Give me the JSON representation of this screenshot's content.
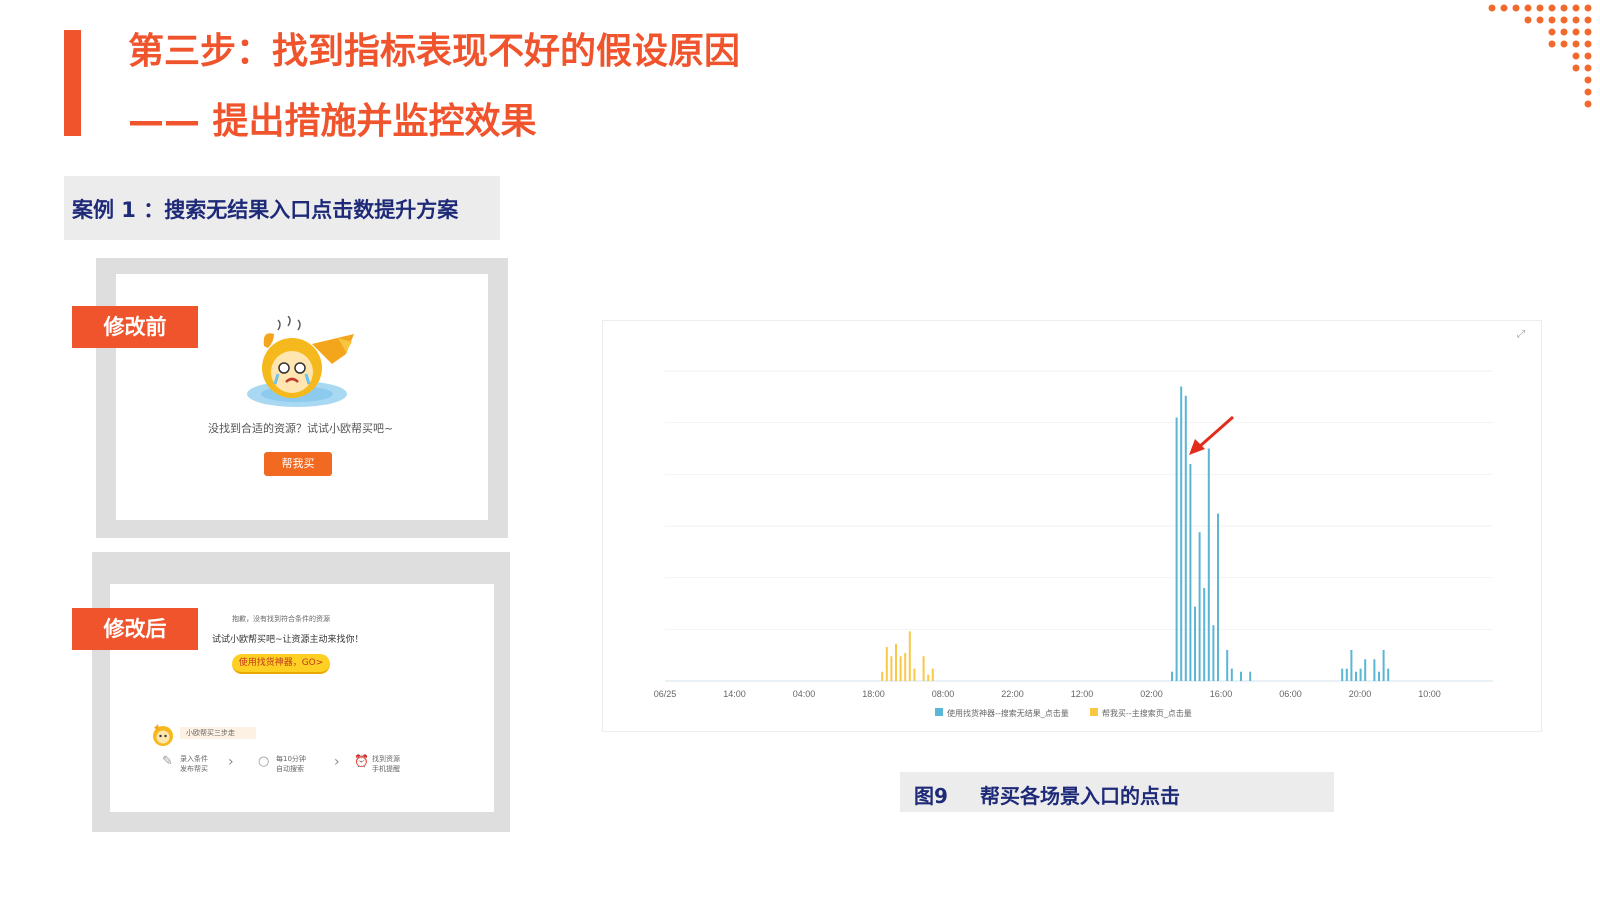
{
  "header": {
    "title_line1": "第三步：找到指标表现不好的假设原因",
    "title_line2": "—— 提出措施并监控效果"
  },
  "case": {
    "label": "案例 1 ：搜索无结果入口点击数提升方案"
  },
  "before": {
    "tag": "修改前",
    "message": "没找到合适的资源？试试小欧帮买吧~",
    "button": "帮我买"
  },
  "after": {
    "tag": "修改后",
    "line1": "抱歉，没有找到符合条件的资源",
    "line2": "试试小欧帮买吧~让资源主动来找你！",
    "button": "使用找货神器，GO>",
    "steps_title": "小欧帮买三步走",
    "steps": [
      {
        "line1": "录入条件",
        "line2": "发布帮买"
      },
      {
        "line1": "每10分钟",
        "line2": "自动搜索"
      },
      {
        "line1": "找到资源",
        "line2": "手机提醒"
      }
    ]
  },
  "chart_data": {
    "type": "bar",
    "x_tick_labels": [
      "06/25",
      "14:00",
      "04:00",
      "18:00",
      "08:00",
      "22:00",
      "12:00",
      "02:00",
      "16:00",
      "06:00",
      "20:00",
      "10:00"
    ],
    "y_axis_labels_shown": false,
    "grid": true,
    "legend_position": "bottom",
    "series": [
      {
        "name": "使用找货神器--搜索无结果_点击量",
        "color": "#5bb6d6",
        "values": [
          0,
          0,
          0,
          0,
          0,
          0,
          0,
          0,
          0,
          0,
          0,
          0,
          0,
          0,
          0,
          0,
          0,
          0,
          0,
          0,
          0,
          0,
          0,
          0,
          0,
          0,
          0,
          0,
          0,
          0,
          0,
          0,
          0,
          0,
          0,
          0,
          0,
          0,
          0,
          0,
          0,
          0,
          0,
          0,
          0,
          0,
          0,
          0,
          0,
          0,
          0,
          0,
          0,
          0,
          0,
          0,
          0,
          0,
          0,
          0,
          0,
          0,
          0,
          0,
          0,
          0,
          0,
          0,
          0,
          0,
          0,
          0,
          0,
          0,
          0,
          0,
          0,
          0,
          0,
          0,
          0,
          0,
          0,
          0,
          0,
          0,
          0,
          0,
          0,
          0,
          0,
          0,
          0,
          0,
          0,
          0,
          0,
          0,
          0,
          0,
          0,
          0,
          0,
          0,
          0,
          0,
          0,
          0,
          0,
          0,
          0,
          0,
          0,
          0,
          0,
          0,
          0,
          0,
          0,
          0,
          0,
          0,
          0,
          0,
          0,
          0,
          0,
          0,
          0,
          0,
          0,
          0,
          0,
          0,
          0,
          0,
          0,
          0,
          0,
          0,
          0,
          0,
          0,
          0,
          0,
          0,
          0,
          0,
          0,
          0,
          0,
          0,
          0,
          0,
          0,
          0,
          0,
          0,
          0,
          0,
          0,
          0,
          0,
          0,
          0,
          0,
          0,
          0,
          0,
          0,
          0,
          0,
          0,
          0,
          0,
          0,
          0,
          0,
          0,
          0,
          0,
          0,
          0,
          0,
          0,
          0,
          0,
          0,
          0,
          0,
          0,
          0,
          0,
          0,
          0,
          0,
          0,
          0,
          0,
          0,
          0,
          0,
          0,
          0,
          0,
          0,
          0,
          0,
          0,
          0,
          0,
          0,
          0,
          0,
          0,
          0,
          0,
          0,
          0,
          0,
          3,
          0,
          85,
          0,
          95,
          0,
          92,
          0,
          70,
          0,
          24,
          0,
          48,
          0,
          30,
          0,
          75,
          0,
          18,
          0,
          54,
          0,
          0,
          0,
          10,
          0,
          4,
          0,
          0,
          0,
          3,
          0,
          0,
          0,
          3,
          0,
          0,
          0,
          0,
          0,
          0,
          0,
          0,
          0,
          0,
          0,
          0,
          0,
          0,
          0,
          0,
          0,
          0,
          0,
          0,
          0,
          0,
          0,
          0,
          0,
          0,
          0,
          0,
          0,
          0,
          0,
          0,
          0,
          0,
          0,
          0,
          0,
          0,
          0,
          4,
          0,
          4,
          0,
          10,
          0,
          3,
          0,
          4,
          0,
          7,
          0,
          0,
          0,
          7,
          0,
          3,
          0,
          10,
          0,
          4,
          0,
          0,
          0,
          0,
          0,
          0,
          0,
          0,
          0,
          0,
          0,
          0,
          0,
          0,
          0,
          0,
          0,
          0,
          0,
          0,
          0,
          0,
          0,
          0,
          0,
          0,
          0,
          0,
          0,
          0,
          0,
          0,
          0,
          0,
          0,
          0,
          0,
          0,
          0,
          0,
          0,
          0,
          0,
          0,
          0
        ]
      },
      {
        "name": "帮我买--主搜索页_点击量",
        "color": "#f9c847",
        "values": [
          0,
          0,
          0,
          0,
          0,
          0,
          0,
          0,
          0,
          0,
          0,
          0,
          0,
          0,
          0,
          0,
          0,
          0,
          0,
          0,
          0,
          0,
          0,
          0,
          0,
          0,
          0,
          0,
          0,
          0,
          0,
          0,
          0,
          0,
          0,
          0,
          0,
          0,
          0,
          0,
          0,
          0,
          0,
          0,
          0,
          0,
          0,
          0,
          0,
          0,
          0,
          0,
          0,
          0,
          0,
          0,
          0,
          0,
          0,
          0,
          0,
          0,
          0,
          0,
          0,
          0,
          0,
          0,
          0,
          0,
          0,
          0,
          0,
          0,
          0,
          0,
          0,
          0,
          0,
          0,
          0,
          0,
          0,
          0,
          0,
          0,
          0,
          0,
          0,
          0,
          0,
          0,
          0,
          0,
          3,
          0,
          11,
          0,
          8,
          0,
          12,
          0,
          8,
          0,
          9,
          0,
          16,
          0,
          4,
          0,
          0,
          0,
          8,
          0,
          2,
          0,
          4,
          0,
          0,
          0,
          0,
          0,
          0,
          0,
          0,
          0,
          0,
          0,
          0,
          0,
          0,
          0,
          0,
          0,
          0,
          0,
          0,
          0,
          0,
          0,
          0,
          0,
          0,
          0,
          0,
          0,
          0,
          0,
          0,
          0,
          0,
          0,
          0,
          0,
          0,
          0,
          0,
          0,
          0,
          0,
          0,
          0,
          0,
          0,
          0,
          0,
          0,
          0,
          0,
          0,
          0,
          0,
          0,
          0,
          0,
          0,
          0,
          0,
          0,
          0,
          0,
          0,
          0,
          0,
          0,
          0,
          0,
          0,
          0,
          0,
          0,
          0,
          0,
          0,
          0,
          0,
          0,
          0,
          0,
          0,
          0,
          0,
          0,
          0,
          0,
          0,
          0,
          0,
          0,
          0,
          0,
          0,
          0,
          0,
          0,
          0,
          0,
          0,
          0,
          0,
          0,
          0,
          0,
          0,
          0,
          0,
          0,
          0,
          0,
          0,
          0,
          0,
          0,
          0,
          0,
          0,
          0,
          0,
          0,
          0,
          0,
          0,
          0,
          0,
          0,
          0,
          0,
          0,
          0,
          0,
          0,
          0,
          0,
          0,
          0,
          0,
          0,
          0,
          0,
          0,
          0,
          0,
          0,
          0,
          0,
          0,
          0,
          0,
          0,
          0,
          0,
          0,
          0,
          0,
          0,
          0,
          0,
          0,
          0,
          0,
          0,
          0,
          0,
          0,
          0,
          0,
          0,
          0,
          0,
          0,
          0,
          0,
          0,
          0,
          0,
          0,
          0,
          0,
          0,
          0,
          0,
          0,
          0,
          0,
          0,
          0,
          0,
          0,
          0,
          0,
          0,
          0,
          0,
          0,
          0,
          0,
          0,
          0,
          0,
          0,
          0,
          0,
          0,
          0,
          0,
          0,
          0,
          0,
          0,
          0,
          0,
          0,
          0,
          0,
          0,
          0,
          0,
          0,
          0,
          0,
          0,
          0,
          0,
          0,
          0,
          0,
          0,
          0,
          0,
          0,
          0,
          0,
          0,
          0
        ]
      }
    ]
  },
  "caption": {
    "fig": "图9",
    "text": "帮买各场景入口的点击"
  },
  "colors": {
    "accent": "#f0542d",
    "navy": "#1e2a78",
    "series_blue": "#5bb6d6",
    "series_yellow": "#f9c847"
  }
}
